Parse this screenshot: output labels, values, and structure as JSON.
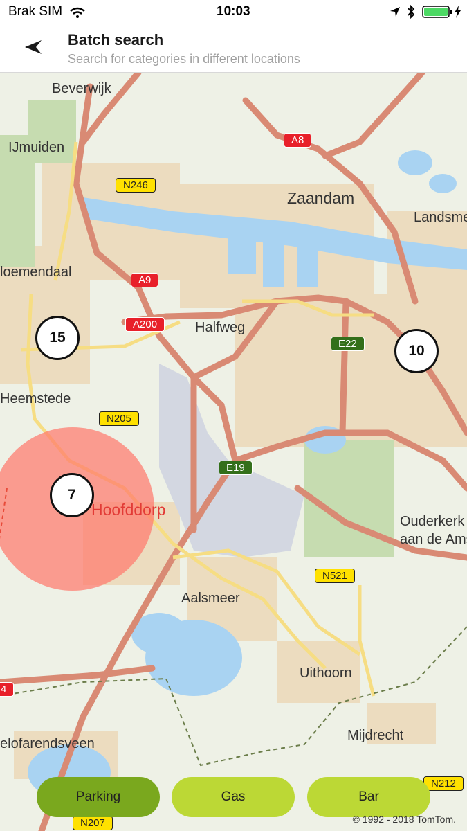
{
  "status_bar": {
    "carrier": "Brak SIM",
    "time": "10:03"
  },
  "header": {
    "title": "Batch search",
    "subtitle": "Search for categories in different locations"
  },
  "map": {
    "places": [
      "Beverwijk",
      "IJmuiden",
      "Zaandam",
      "Landsme",
      "loemendaal",
      "Halfweg",
      "Heemstede",
      "Hoofddorp",
      "Ouderkerk",
      "aan de Amst",
      "Aalsmeer",
      "Uithoorn",
      "Mijdrecht",
      "elofarendsveen"
    ],
    "roads": [
      "A8",
      "N246",
      "A9",
      "A200",
      "E22",
      "N205",
      "E19",
      "N521",
      "N212",
      "N207",
      "4"
    ],
    "clusters": [
      "15",
      "10",
      "7"
    ]
  },
  "buttons": {
    "parking": "Parking",
    "gas": "Gas",
    "bar": "Bar"
  },
  "colors": {
    "parking_active": "#7aa81e",
    "chip": "#bcd835",
    "search_radius": "#ff7a6e"
  },
  "copyright": "© 1992 - 2018 TomTom."
}
